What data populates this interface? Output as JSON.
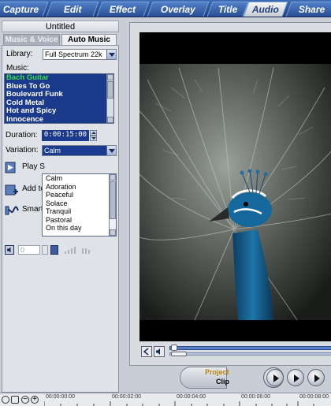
{
  "tabs": [
    {
      "label": "Capture",
      "active": false
    },
    {
      "label": "Edit",
      "active": false
    },
    {
      "label": "Effect",
      "active": false
    },
    {
      "label": "Overlay",
      "active": false
    },
    {
      "label": "Title",
      "active": false
    },
    {
      "label": "Audio",
      "active": true
    },
    {
      "label": "Share",
      "active": false
    }
  ],
  "panel": {
    "title": "Untitled",
    "subtabs": {
      "music_voice": "Music & Voice",
      "auto_music": "Auto Music"
    },
    "library_label": "Library:",
    "library_value": "Full Spectrum 22k",
    "music_label": "Music:",
    "music_items": [
      "Bach Guitar",
      "Blues To Go",
      "Boulevard Funk",
      "Cold Metal",
      "Hot and Spicy",
      "Innocence"
    ],
    "music_selected": "Bach Guitar",
    "duration_label": "Duration:",
    "duration_value": "0:00:15:00",
    "variation_label": "Variation:",
    "variation_value": "Calm",
    "variation_options": [
      "Calm",
      "Adoration",
      "Peaceful",
      "Solace",
      "Tranquil",
      "Pastoral",
      "On this day"
    ],
    "actions": {
      "play": "Play S",
      "add": "Add to",
      "smart": "Smart"
    },
    "volume_value": "0"
  },
  "preview": {
    "project_label": "Project",
    "clip_label": "Clip"
  },
  "timeline": {
    "ticks": [
      "00:00:00:00",
      "00:00:02:00",
      "00:00:04:00",
      "00:00:06:00",
      "00:00:08:00"
    ]
  },
  "colors": {
    "tab_blue": "#2a4f92",
    "list_bg": "#1c3a8c",
    "selected_item": "#38e04a",
    "panel_gray": "#c9ced6"
  }
}
